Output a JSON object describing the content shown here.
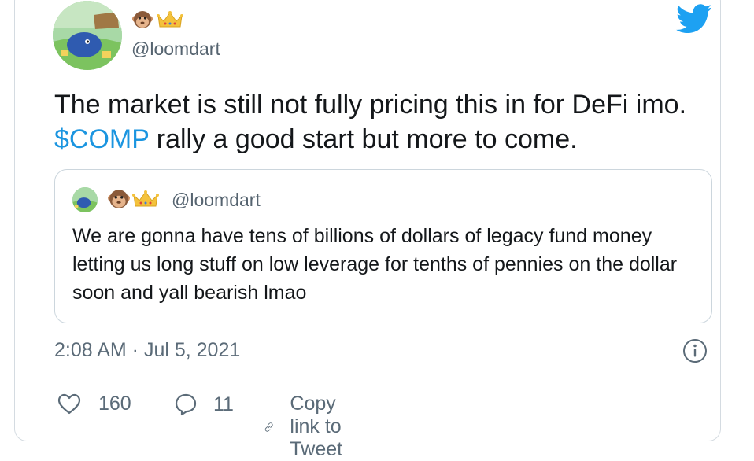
{
  "tweet": {
    "author_handle": "@loomdart",
    "text_part1": "The market is still not fully pricing this in for DeFi imo. ",
    "cashtag": "$COMP",
    "text_part2": " rally a good start but more to come.",
    "timestamp": "2:08 AM · Jul 5, 2021"
  },
  "quoted_tweet": {
    "author_handle": "@loomdart",
    "text": "We are gonna have tens of billions of dollars of legacy fund money letting us long stuff on low leverage for tenths of pennies on the dollar soon and yall bearish lmao"
  },
  "actions": {
    "likes": "160",
    "replies": "11",
    "copy_link": "Copy link to Tweet"
  },
  "icons": {
    "brand": "twitter-bird-icon",
    "emoji_1": "monkey-face-emoji",
    "emoji_2": "crown-emoji"
  },
  "colors": {
    "accent": "#1da1f2",
    "cashtag": "#1b95e0",
    "secondary_text": "#5b6b78",
    "border": "#d4dbe1"
  }
}
